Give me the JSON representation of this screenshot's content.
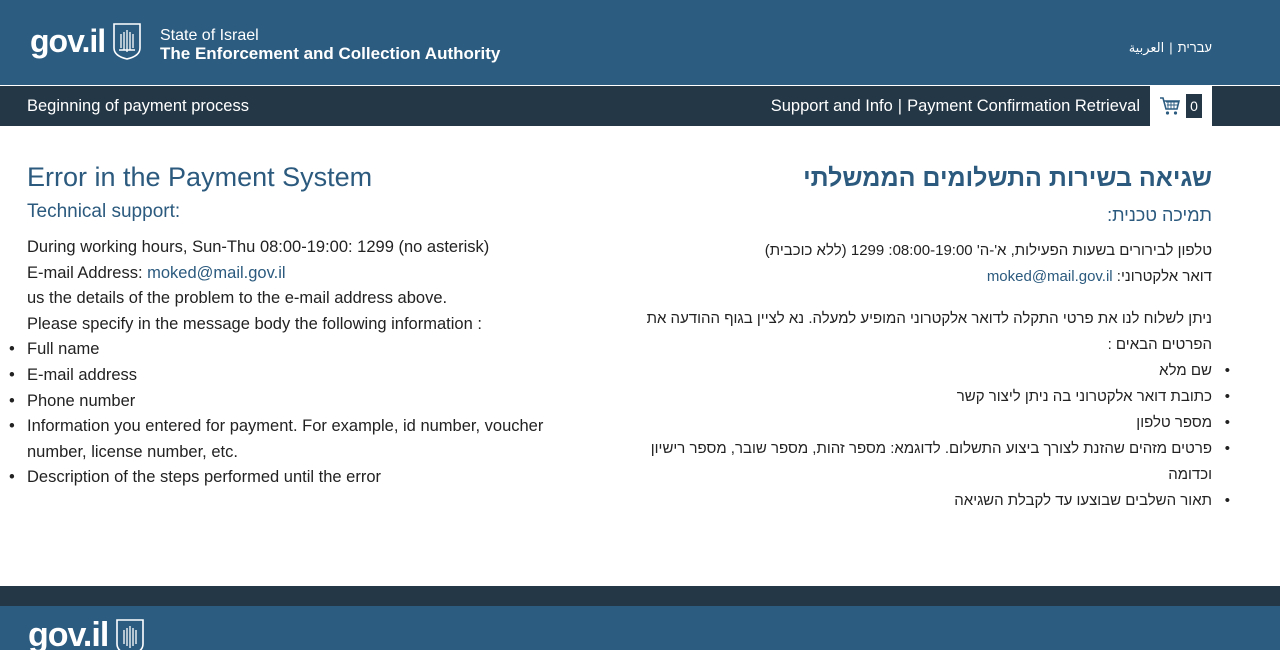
{
  "header": {
    "logo": "gov.il",
    "authority_line1": "State of Israel",
    "authority_line2": "The Enforcement and Collection Authority",
    "lang_hebrew": "עברית",
    "lang_arabic": "العربية",
    "lang_sep": "|"
  },
  "nav": {
    "left": "Beginning of payment process",
    "support": "Support and Info",
    "sep": "|",
    "retrieval": "Payment Confirmation Retrieval",
    "cart_count": "0"
  },
  "english": {
    "title": "Error in the Payment System",
    "support_heading": "Technical support:",
    "hours": "During working hours, Sun-Thu 08:00-19:00: 1299 (no asterisk)",
    "email_label": "E-mail Address: ",
    "email": "moked@mail.gov.il",
    "send_line": "us the details of the problem to the e-mail address above.",
    "specify_line": "Please specify in the message body the following information :",
    "items": [
      "Full name",
      "E-mail address",
      "Phone number",
      "Information you entered for payment. For example, id number, voucher number, license number, etc.",
      "Description of the steps performed until the error"
    ]
  },
  "hebrew": {
    "title": "שגיאה בשירות התשלומים הממשלתי",
    "support_heading": "תמיכה טכנית:",
    "hours": "טלפון לבירורים בשעות הפעילות, א'-ה' 08:00-19:00: 1299 (ללא כוכבית)",
    "email_label": "דואר אלקטרוני: ",
    "email": "moked@mail.gov.il",
    "send_line": "ניתן לשלוח לנו את פרטי התקלה לדואר אלקטרוני המופיע למעלה. נא לציין בגוף ההודעה את הפרטים הבאים :",
    "items": [
      "שם מלא",
      "כתובת דואר אלקטרוני בה ניתן ליצור קשר",
      "מספר טלפון",
      "פרטים מזהים שהזנת לצורך ביצוע התשלום. לדוגמא: מספר זהות, מספר שובר, מספר רישיון וכדומה",
      "תאור השלבים שבוצעו עד לקבלת השגיאה"
    ]
  },
  "footer": {
    "logo": "gov.il"
  },
  "colors": {
    "header_blue": "#2c5c80",
    "nav_dark": "#243746",
    "heading_blue": "#2b5a7e"
  }
}
